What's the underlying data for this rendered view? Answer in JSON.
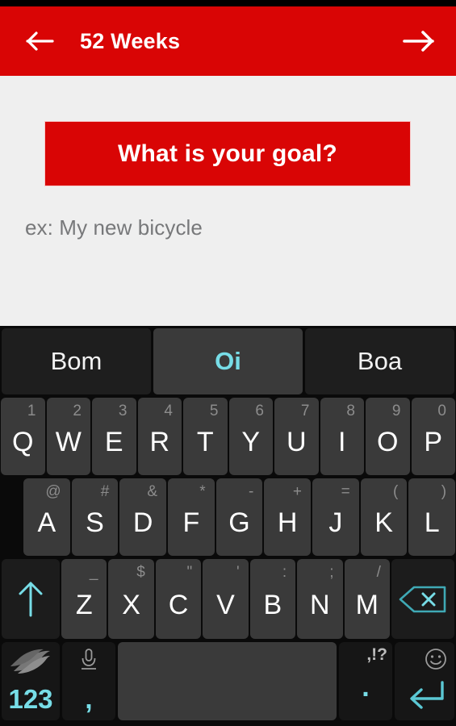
{
  "app": {
    "status_bar_color": "#000000",
    "accent_red": "#D90505",
    "accent_teal": "#1E9189",
    "keyboard_cyan": "#77DDE7"
  },
  "action_bar": {
    "title": "52 Weeks",
    "back_icon": "arrow-left-icon",
    "next_icon": "arrow-right-icon"
  },
  "content": {
    "banner_label": "What is your goal?",
    "goal_placeholder": "ex: My new bicycle",
    "goal_value": ""
  },
  "keyboard": {
    "suggestions": [
      {
        "label": "Bom",
        "active": false
      },
      {
        "label": "Oi",
        "active": true
      },
      {
        "label": "Boa",
        "active": false
      }
    ],
    "row1": [
      {
        "main": "Q",
        "alt": "1"
      },
      {
        "main": "W",
        "alt": "2"
      },
      {
        "main": "E",
        "alt": "3"
      },
      {
        "main": "R",
        "alt": "4"
      },
      {
        "main": "T",
        "alt": "5"
      },
      {
        "main": "Y",
        "alt": "6"
      },
      {
        "main": "U",
        "alt": "7"
      },
      {
        "main": "I",
        "alt": "8"
      },
      {
        "main": "O",
        "alt": "9"
      },
      {
        "main": "P",
        "alt": "0"
      }
    ],
    "row2": [
      {
        "main": "A",
        "alt": "@"
      },
      {
        "main": "S",
        "alt": "#"
      },
      {
        "main": "D",
        "alt": "&"
      },
      {
        "main": "F",
        "alt": "*"
      },
      {
        "main": "G",
        "alt": "-"
      },
      {
        "main": "H",
        "alt": "+"
      },
      {
        "main": "J",
        "alt": "="
      },
      {
        "main": "K",
        "alt": "("
      },
      {
        "main": "L",
        "alt": ")"
      }
    ],
    "row3": [
      {
        "main": "Z",
        "alt": "_"
      },
      {
        "main": "X",
        "alt": "$"
      },
      {
        "main": "C",
        "alt": "\""
      },
      {
        "main": "V",
        "alt": "'"
      },
      {
        "main": "B",
        "alt": ":"
      },
      {
        "main": "N",
        "alt": ";"
      },
      {
        "main": "M",
        "alt": "/"
      }
    ],
    "shift_icon": "shift-arrow-up-icon",
    "backspace_icon": "backspace-delete-icon",
    "row4": {
      "symbols_label": "123",
      "symbols_icon": "swiftkey-logo-icon",
      "comma_label": ",",
      "comma_icon": "microphone-icon",
      "space_label": "",
      "period_label": ".",
      "period_alt": ",!?",
      "enter_icon": "enter-return-icon",
      "emoji_icon": "smiley-face-icon"
    }
  }
}
